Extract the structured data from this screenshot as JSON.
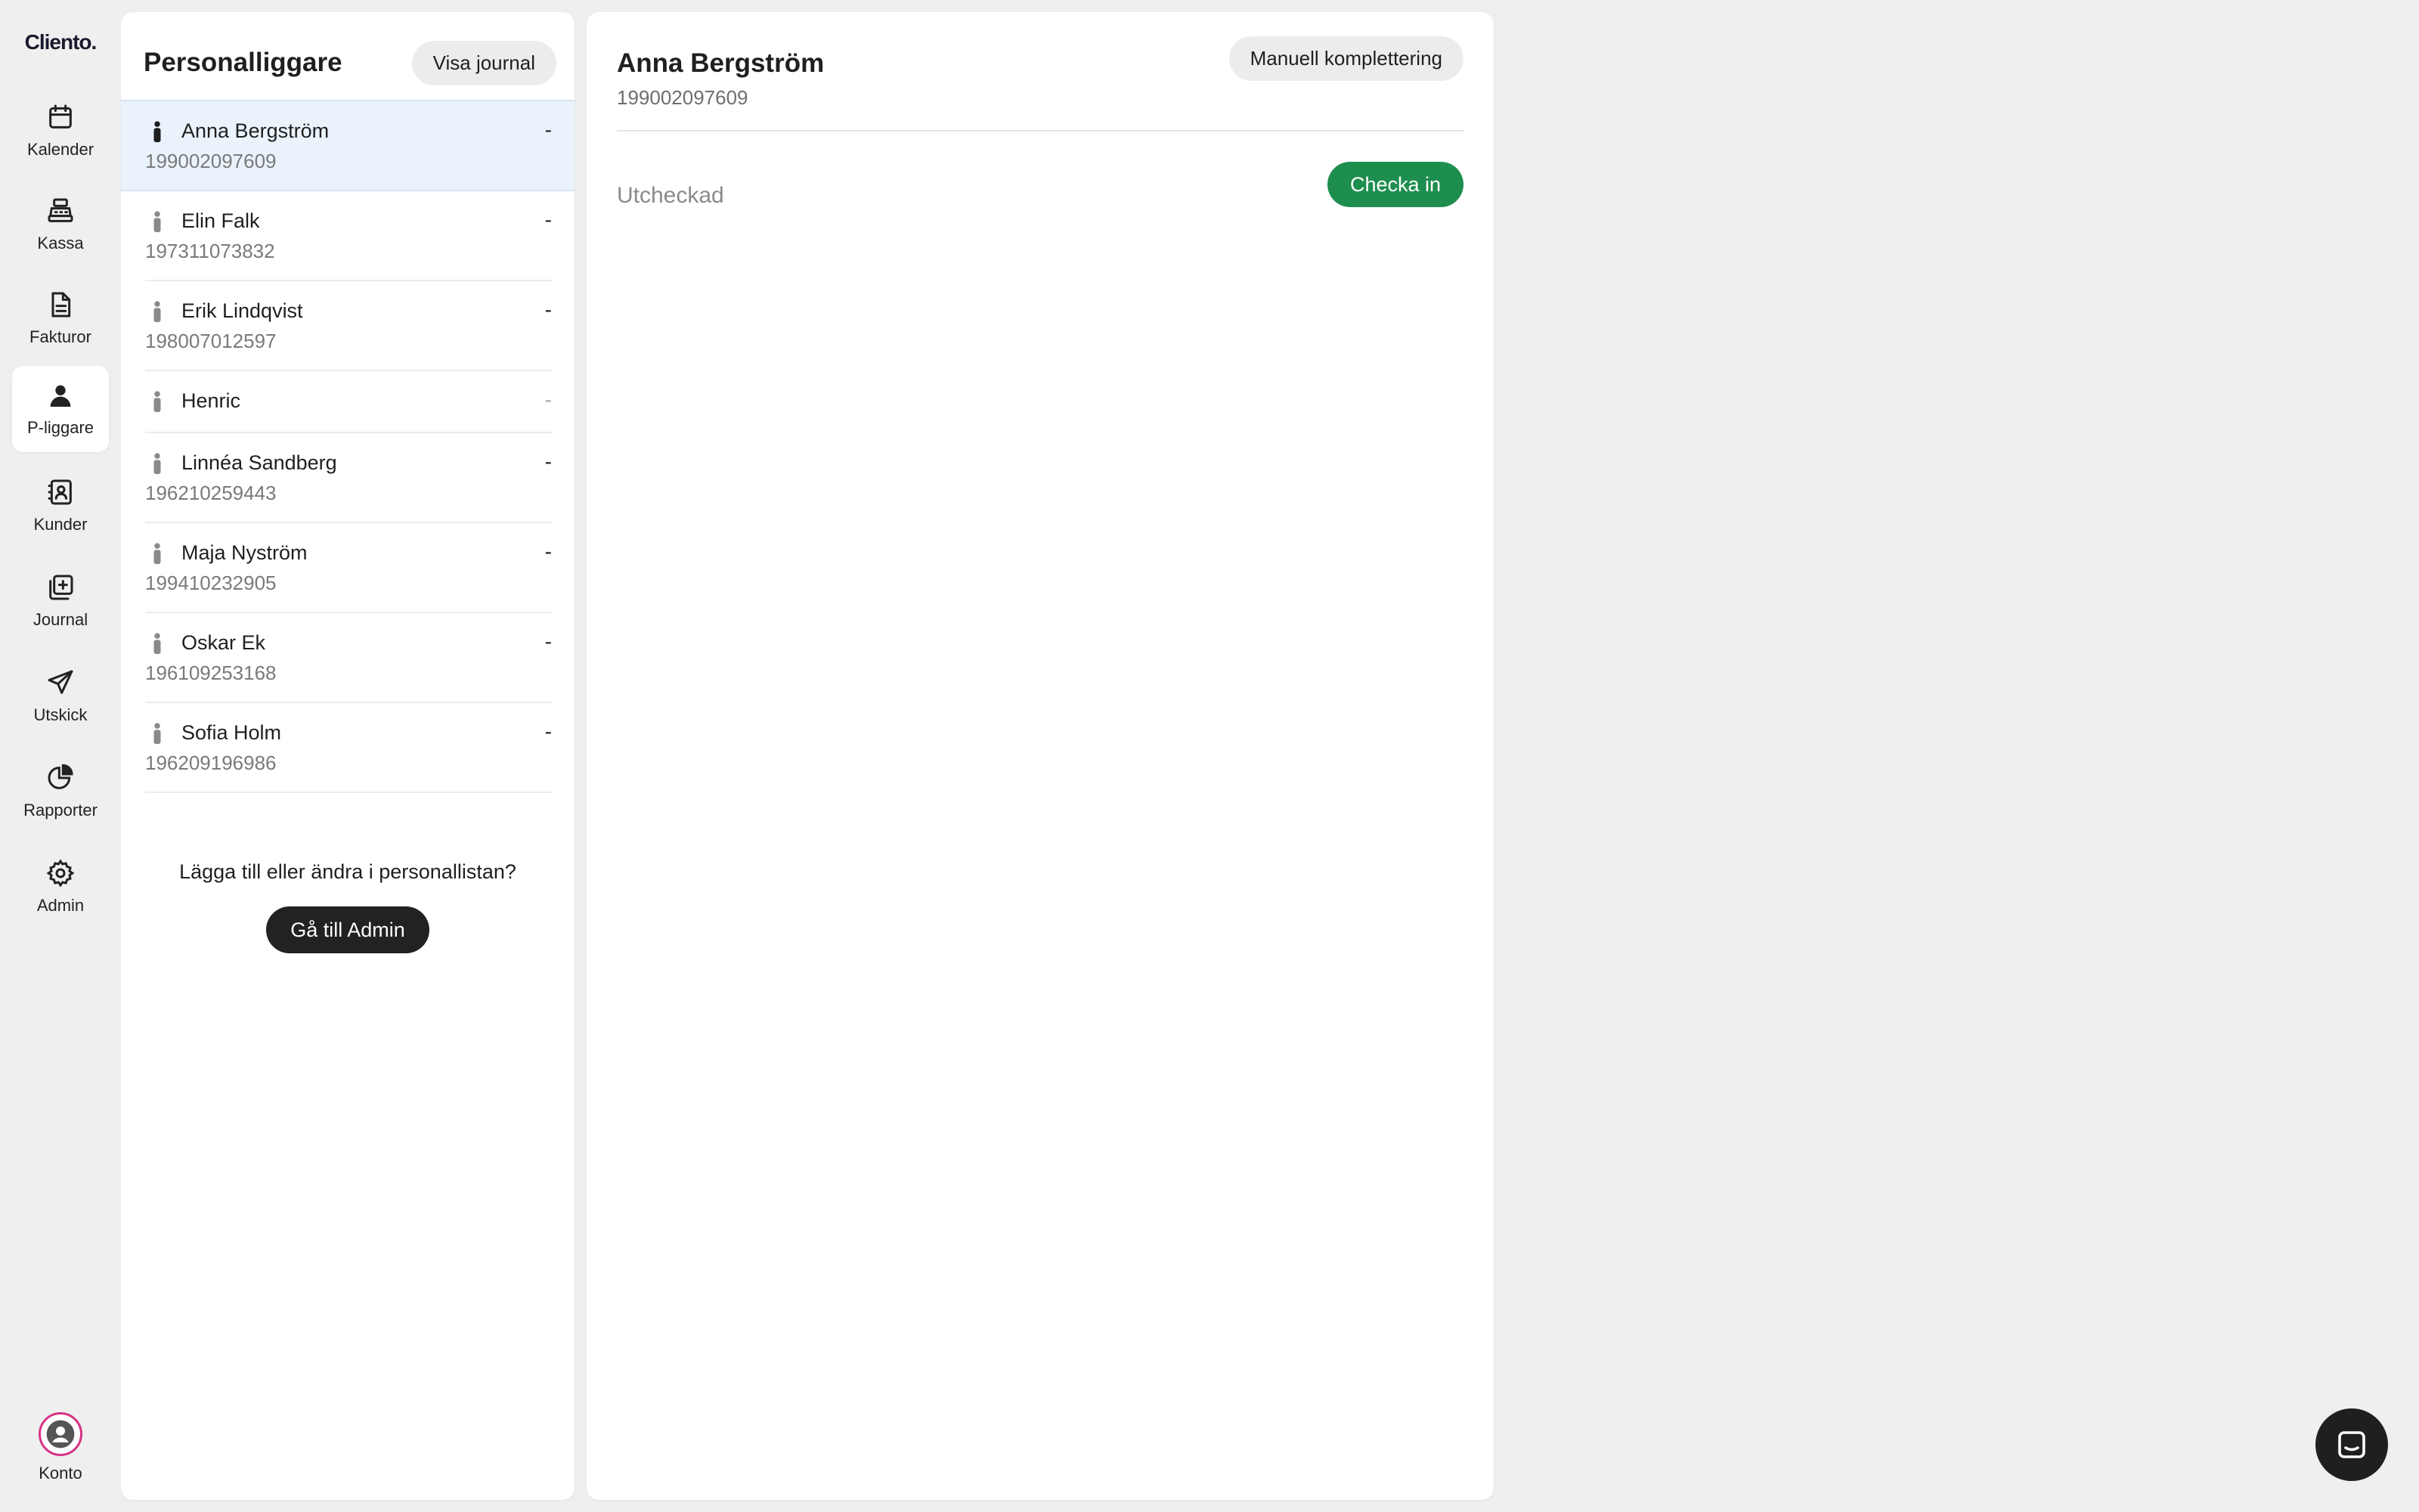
{
  "app": {
    "logo": "Cliento."
  },
  "nav": {
    "items": [
      {
        "label": "Kalender",
        "icon": "calendar-icon"
      },
      {
        "label": "Kassa",
        "icon": "cash-register-icon"
      },
      {
        "label": "Fakturor",
        "icon": "document-icon"
      },
      {
        "label": "P-liggare",
        "icon": "person-icon",
        "active": true
      },
      {
        "label": "Kunder",
        "icon": "contact-card-icon"
      },
      {
        "label": "Journal",
        "icon": "journal-add-icon"
      },
      {
        "label": "Utskick",
        "icon": "send-icon"
      },
      {
        "label": "Rapporter",
        "icon": "pie-chart-icon"
      },
      {
        "label": "Admin",
        "icon": "gear-icon"
      }
    ],
    "account": {
      "label": "Konto",
      "icon": "account-icon"
    }
  },
  "list": {
    "title": "Personalliggare",
    "journal_button": "Visa journal",
    "rows": [
      {
        "name": "Anna Bergström",
        "id": "199002097609",
        "status": "-"
      },
      {
        "name": "Elin Falk",
        "id": "197311073832",
        "status": "-"
      },
      {
        "name": "Erik Lindqvist",
        "id": "198007012597",
        "status": "-"
      },
      {
        "name": "Henric",
        "id": "",
        "status": "-"
      },
      {
        "name": "Linnéa Sandberg",
        "id": "196210259443",
        "status": "-"
      },
      {
        "name": "Maja Nyström",
        "id": "199410232905",
        "status": "-"
      },
      {
        "name": "Oskar Ek",
        "id": "196109253168",
        "status": "-"
      },
      {
        "name": "Sofia Holm",
        "id": "196209196986",
        "status": "-"
      }
    ],
    "admin_prompt": "Lägga till eller ändra i personallistan?",
    "admin_button": "Gå till Admin"
  },
  "detail": {
    "name": "Anna Bergström",
    "id": "199002097609",
    "manual_button": "Manuell komplettering",
    "status": "Utcheckad",
    "checkin_button": "Checka in"
  },
  "colors": {
    "accent_green": "#1e8e4f",
    "selected_row": "#eaf3fb",
    "account_ring": "#d63384"
  }
}
